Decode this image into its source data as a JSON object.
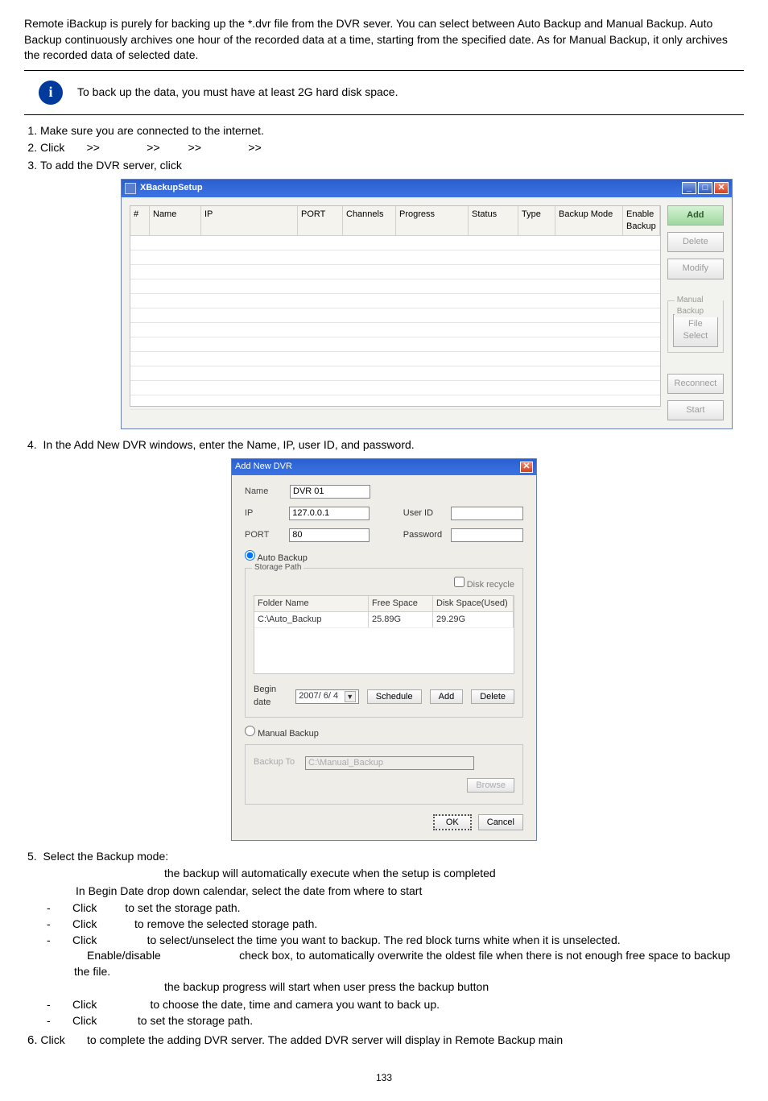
{
  "intro": "Remote iBackup is purely for backing up the *.dvr file from the DVR sever. You can select between Auto Backup and Manual Backup. Auto Backup continuously archives one hour of the recorded data at a time, starting from the specified date. As for Manual Backup, it only archives the recorded data of selected date.",
  "info_note": "To back up the data, you must have at least 2G hard disk space.",
  "steps": {
    "s1": "Make sure you are connected to the internet.",
    "s2_prefix": "Click",
    "arr": ">>",
    "s3": "To add the DVR server, click",
    "s4": "In the Add New DVR windows, enter the Name, IP, user ID, and password.",
    "s5": "Select the Backup mode:",
    "s6": "Click       to complete the adding DVR server. The added DVR server will display in Remote Backup main"
  },
  "shot1": {
    "title": "XBackupSetup",
    "headers": {
      "num": "#",
      "name": "Name",
      "ip": "IP",
      "port": "PORT",
      "chan": "Channels",
      "prog": "Progress",
      "status": "Status",
      "type": "Type",
      "mode": "Backup Mode",
      "enable": "Enable Backup"
    },
    "buttons": {
      "add": "Add",
      "delete": "Delete",
      "modify": "Modify",
      "mbackup": "Manual Backup",
      "filesel": "File Select",
      "reconnect": "Reconnect",
      "start": "Start"
    }
  },
  "shot2": {
    "title": "Add New DVR",
    "labels": {
      "name": "Name",
      "ip": "IP",
      "port": "PORT",
      "userid": "User ID",
      "password": "Password",
      "auto": "Auto Backup",
      "storage": "Storage Path",
      "diskrec": "Disk recycle",
      "folder": "Folder Name",
      "free": "Free Space",
      "used": "Disk Space(Used)",
      "begin": "Begin date",
      "manual": "Manual Backup",
      "backupto": "Backup To"
    },
    "values": {
      "name": "DVR 01",
      "ip": "127.0.0.1",
      "port": "80",
      "folder": "C:\\Auto_Backup",
      "free": "25.89G",
      "used": "29.29G",
      "date": "2007/ 6/ 4",
      "browseval": "C:\\Manual_Backup"
    },
    "buttons": {
      "schedule": "Schedule",
      "add": "Add",
      "delete": "Delete",
      "browse": "Browse",
      "ok": "OK",
      "cancel": "Cancel"
    }
  },
  "sect5": {
    "auto_line": "the backup will automatically execute when the setup is completed",
    "begin_line": "In Begin Date drop down calendar, select the date from where to start",
    "b1": "Click         to set the storage path.",
    "b2": "Click            to remove the selected storage path.",
    "b3": "Click                to select/unselect the time you want to backup. The red block turns white when it is unselected.",
    "b3b": "Enable/disable                         check box, to automatically overwrite the oldest file when there is not enough free space to backup the file.",
    "manual_line": "the backup progress will start when user press the backup button",
    "b4": "Click                 to choose the date, time and camera you want to back up.",
    "b5": "Click             to set the storage path."
  },
  "page": "133"
}
